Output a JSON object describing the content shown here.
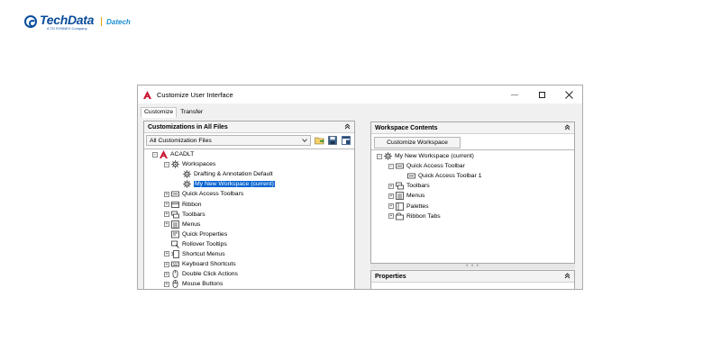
{
  "brand": {
    "name": "TechData",
    "subline": "A TD SYNNEX Company",
    "separator": "|",
    "partner": "Datech"
  },
  "window": {
    "title": "Customize User Interface",
    "controls": {
      "minimize": "—",
      "maximize": "☐",
      "close": "✕"
    }
  },
  "tabs": [
    "Customize",
    "Transfer"
  ],
  "left_panel": {
    "header": "Customizations in All Files",
    "collapse_symbol": "»",
    "file_select": "All Customization Files",
    "tree": [
      {
        "label": "ACADLT",
        "level": 0,
        "expander": "-",
        "icon": "autocad-icon"
      },
      {
        "label": "Workspaces",
        "level": 1,
        "expander": "-",
        "icon": "workspaces-icon"
      },
      {
        "label": "Drafting & Annotation Default",
        "level": 2,
        "expander": "",
        "icon": "workspace-gear-icon"
      },
      {
        "label": "My New Workspace (current)",
        "level": 2,
        "expander": "",
        "icon": "workspace-gear-icon",
        "selected": true
      },
      {
        "label": "Quick Access Toolbars",
        "level": 1,
        "expander": "+",
        "icon": "toolbar-icon"
      },
      {
        "label": "Ribbon",
        "level": 1,
        "expander": "+",
        "icon": "ribbon-icon"
      },
      {
        "label": "Toolbars",
        "level": 1,
        "expander": "+",
        "icon": "toolbars-icon"
      },
      {
        "label": "Menus",
        "level": 1,
        "expander": "+",
        "icon": "menus-icon"
      },
      {
        "label": "Quick Properties",
        "level": 1,
        "expander": "",
        "icon": "quick-properties-icon"
      },
      {
        "label": "Rollover Tooltips",
        "level": 1,
        "expander": "",
        "icon": "rollover-tooltips-icon"
      },
      {
        "label": "Shortcut Menus",
        "level": 1,
        "expander": "+",
        "icon": "shortcut-menus-icon"
      },
      {
        "label": "Keyboard Shortcuts",
        "level": 1,
        "expander": "+",
        "icon": "keyboard-shortcuts-icon"
      },
      {
        "label": "Double Click Actions",
        "level": 1,
        "expander": "+",
        "icon": "double-click-icon"
      },
      {
        "label": "Mouse Buttons",
        "level": 1,
        "expander": "+",
        "icon": "mouse-buttons-icon"
      }
    ]
  },
  "right_panel": {
    "header": "Workspace Contents",
    "collapse_symbol": "»",
    "sub_tab": "Customize Workspace",
    "tree": [
      {
        "label": "My New Workspace (current)",
        "level": 0,
        "expander": "-",
        "icon": "workspace-gear-icon"
      },
      {
        "label": "Quick Access Toolbar",
        "level": 1,
        "expander": "-",
        "icon": "toolbar-icon"
      },
      {
        "label": "Quick Access Toolbar 1",
        "level": 2,
        "expander": "",
        "icon": "toolbar-item-icon"
      },
      {
        "label": "Toolbars",
        "level": 1,
        "expander": "+",
        "icon": "toolbars-icon"
      },
      {
        "label": "Menus",
        "level": 1,
        "expander": "+",
        "icon": "menus-icon"
      },
      {
        "label": "Palettes",
        "level": 1,
        "expander": "+",
        "icon": "palettes-icon"
      },
      {
        "label": "Ribbon Tabs",
        "level": 1,
        "expander": "+",
        "icon": "ribbon-tabs-icon"
      }
    ]
  },
  "properties_panel": {
    "header": "Properties",
    "collapse_symbol": "»"
  }
}
